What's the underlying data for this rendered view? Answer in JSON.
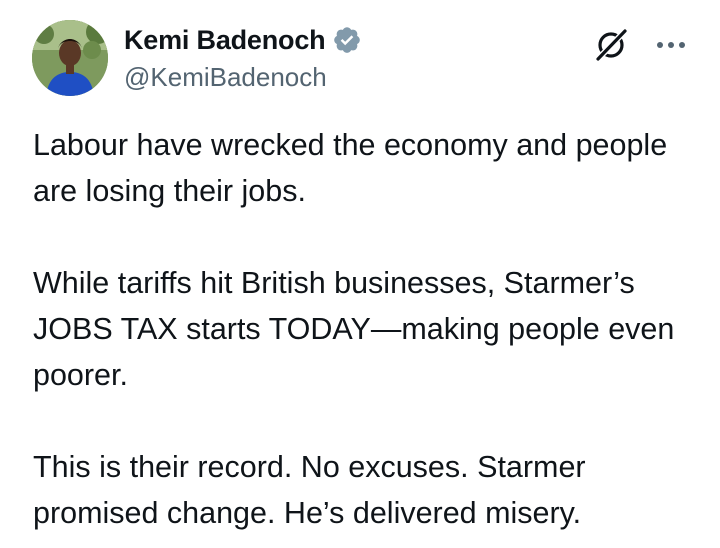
{
  "author": {
    "display_name": "Kemi Badenoch",
    "handle": "@KemiBadenoch",
    "verified": true,
    "verified_badge_color": "#829aab"
  },
  "icons": {
    "avatar": "profile-photo",
    "verified": "verified-badge-icon",
    "grok": "grok-icon",
    "more": "more-options-icon"
  },
  "tweet": {
    "paragraphs": [
      "Labour have wrecked the economy and people are losing their jobs.",
      "While tariffs hit British businesses, Starmer’s JOBS TAX starts TODAY—making people even poorer.",
      "This is their record. No excuses. Starmer promised change. He’s delivered misery."
    ]
  },
  "colors": {
    "text": "#0f1419",
    "secondary_text": "#536471",
    "background": "#ffffff"
  }
}
